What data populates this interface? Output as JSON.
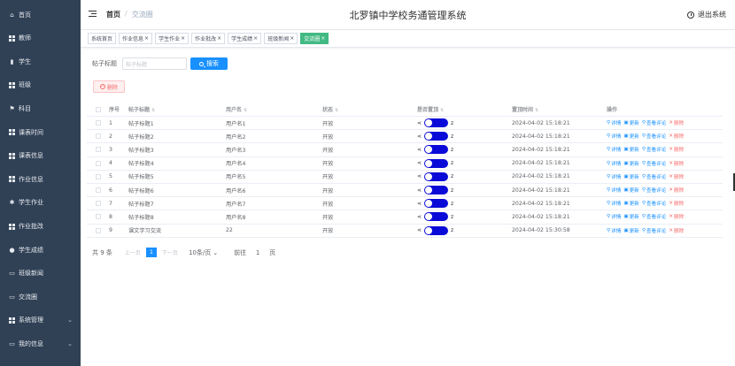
{
  "sidebar": {
    "items": [
      {
        "icon": "home-icon",
        "label": "首页"
      },
      {
        "icon": "grid-icon",
        "label": "教师"
      },
      {
        "icon": "bar-chart-icon",
        "label": "学生"
      },
      {
        "icon": "grid-icon",
        "label": "班级"
      },
      {
        "icon": "flag-icon",
        "label": "科目"
      },
      {
        "icon": "grid-icon",
        "label": "课表时间"
      },
      {
        "icon": "grid-icon",
        "label": "课表信息"
      },
      {
        "icon": "grid-icon",
        "label": "作业信息"
      },
      {
        "icon": "gear-icon",
        "label": "学生作业"
      },
      {
        "icon": "grid-icon",
        "label": "作业批改"
      },
      {
        "icon": "location-icon",
        "label": "学生成绩"
      },
      {
        "icon": "document-icon",
        "label": "班级新闻"
      },
      {
        "icon": "document-icon",
        "label": "交流圈"
      },
      {
        "icon": "grid-icon",
        "label": "系统管理"
      },
      {
        "icon": "document-icon",
        "label": "我的信息"
      }
    ]
  },
  "header": {
    "breadcrumb_home": "首页",
    "breadcrumb_sep": "/",
    "breadcrumb_current": "交流圈",
    "title": "北罗镇中学校务通管理系统",
    "logout": "退出系统"
  },
  "tags": [
    {
      "label": "系统首页",
      "closable": false,
      "active": false
    },
    {
      "label": "作业信息",
      "closable": true,
      "active": false
    },
    {
      "label": "学生作业",
      "closable": true,
      "active": false
    },
    {
      "label": "作业批改",
      "closable": true,
      "active": false
    },
    {
      "label": "学生成绩",
      "closable": true,
      "active": false
    },
    {
      "label": "班级新闻",
      "closable": true,
      "active": false
    },
    {
      "label": "交流圈",
      "closable": true,
      "active": true
    }
  ],
  "search": {
    "label": "帖子标题",
    "placeholder": "帖子标题",
    "button": "搜索"
  },
  "delete_button": "删除",
  "table": {
    "headers": {
      "index": "序号",
      "title": "帖子标题",
      "user": "用户名",
      "status": "状态",
      "top": "是否置顶",
      "time": "置顶时间",
      "ops": "操作"
    },
    "op_labels": {
      "detail": "详情",
      "edit": "更新",
      "comments": "查看评论",
      "delete": "删除"
    },
    "rows": [
      {
        "idx": "1",
        "title": "帖子标题1",
        "user": "用户名1",
        "status": "开放",
        "time": "2024-04-02 15:18:21"
      },
      {
        "idx": "2",
        "title": "帖子标题2",
        "user": "用户名2",
        "status": "开放",
        "time": "2024-04-02 15:18:21"
      },
      {
        "idx": "3",
        "title": "帖子标题3",
        "user": "用户名3",
        "status": "开放",
        "time": "2024-04-02 15:18:21"
      },
      {
        "idx": "4",
        "title": "帖子标题4",
        "user": "用户名4",
        "status": "开放",
        "time": "2024-04-02 15:18:21"
      },
      {
        "idx": "5",
        "title": "帖子标题5",
        "user": "用户名5",
        "status": "开放",
        "time": "2024-04-02 15:18:21"
      },
      {
        "idx": "6",
        "title": "帖子标题6",
        "user": "用户名6",
        "status": "开放",
        "time": "2024-04-02 15:18:21"
      },
      {
        "idx": "7",
        "title": "帖子标题7",
        "user": "用户名7",
        "status": "开放",
        "time": "2024-04-02 15:18:21"
      },
      {
        "idx": "8",
        "title": "帖子标题8",
        "user": "用户名8",
        "status": "开放",
        "time": "2024-04-02 15:18:21"
      },
      {
        "idx": "9",
        "title": "课文学习交流",
        "user": "22",
        "status": "开放",
        "time": "2024-04-02 15:30:58"
      }
    ]
  },
  "pagination": {
    "total": "共 9 条",
    "prev": "上一页",
    "current": "1",
    "next": "下一页",
    "page_size": "10条/页",
    "goto_prefix": "前往",
    "goto_value": "1",
    "goto_suffix": "页"
  },
  "colors": {
    "sidebar": "#304156",
    "primary": "#1890ff",
    "active_tag": "#42b983",
    "switch": "#0a0ad8",
    "danger": "#f56c6c"
  }
}
